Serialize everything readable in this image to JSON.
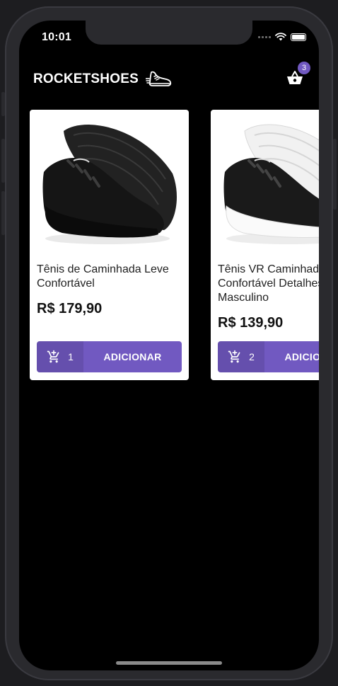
{
  "status_bar": {
    "time": "10:01"
  },
  "header": {
    "brand": "ROCKETSHOES",
    "cart_count": "3"
  },
  "products": [
    {
      "title": "Tênis de Caminhada Leve Confortável",
      "price": "R$ 179,90",
      "amount": "1",
      "button_label": "ADICIONAR",
      "shoe_color": "black"
    },
    {
      "title": "Tênis VR Caminhada Confortável Detalhes Couro Masculino",
      "price": "R$ 139,90",
      "amount": "2",
      "button_label": "ADICIONAR",
      "shoe_color": "black-white"
    }
  ],
  "colors": {
    "accent": "#7159c1",
    "background": "#000000",
    "card": "#ffffff"
  }
}
